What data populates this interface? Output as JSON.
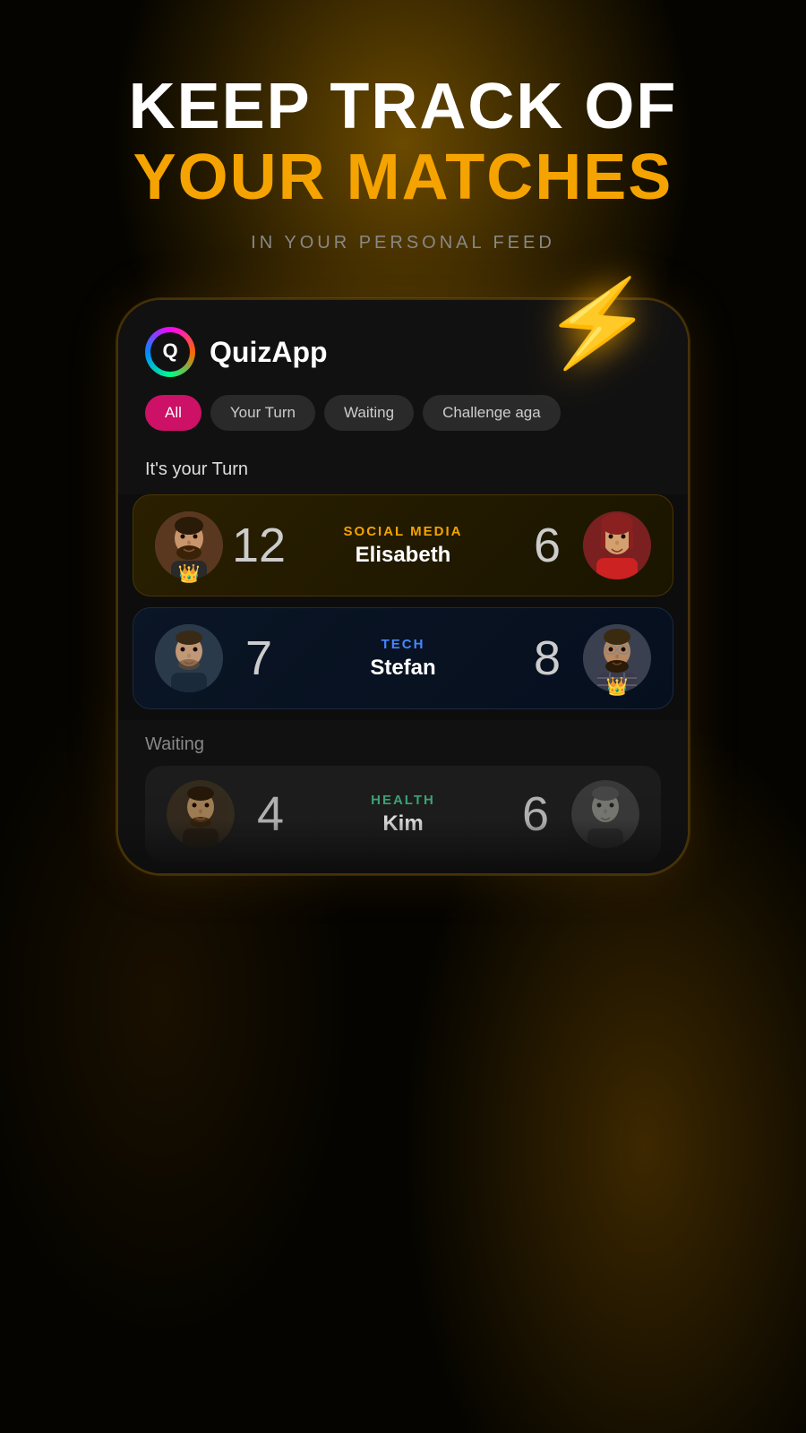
{
  "background": {
    "color_primary": "#0a0800",
    "color_glow": "#6b4a00"
  },
  "title": {
    "line1": "KEEP TRACK OF",
    "line2": "YOUR MATCHES",
    "subtitle": "IN YOUR PERSONAL FEED"
  },
  "lightning": "⚡",
  "app": {
    "name": "QuizApp",
    "logo_symbol": "Q"
  },
  "tabs": [
    {
      "label": "All",
      "active": true
    },
    {
      "label": "Your Turn",
      "active": false
    },
    {
      "label": "Waiting",
      "active": false
    },
    {
      "label": "Challenge aga",
      "active": false
    }
  ],
  "section_your_turn": "It's your Turn",
  "matches": [
    {
      "id": "match-1",
      "my_score": "12",
      "category": "SOCIAL MEDIA",
      "opponent_name": "Elisabeth",
      "opponent_score": "6",
      "style": "gold",
      "my_crown": true,
      "opponent_crown": false
    },
    {
      "id": "match-2",
      "my_score": "7",
      "category": "TECH",
      "opponent_name": "Stefan",
      "opponent_score": "8",
      "style": "blue",
      "my_crown": false,
      "opponent_crown": true
    }
  ],
  "section_waiting": "Waiting",
  "waiting_matches": [
    {
      "id": "wait-1",
      "my_score": "4",
      "category": "HEALTH",
      "opponent_name": "Kim",
      "opponent_score": "6",
      "style": "dark",
      "my_crown": false,
      "opponent_crown": false
    }
  ]
}
